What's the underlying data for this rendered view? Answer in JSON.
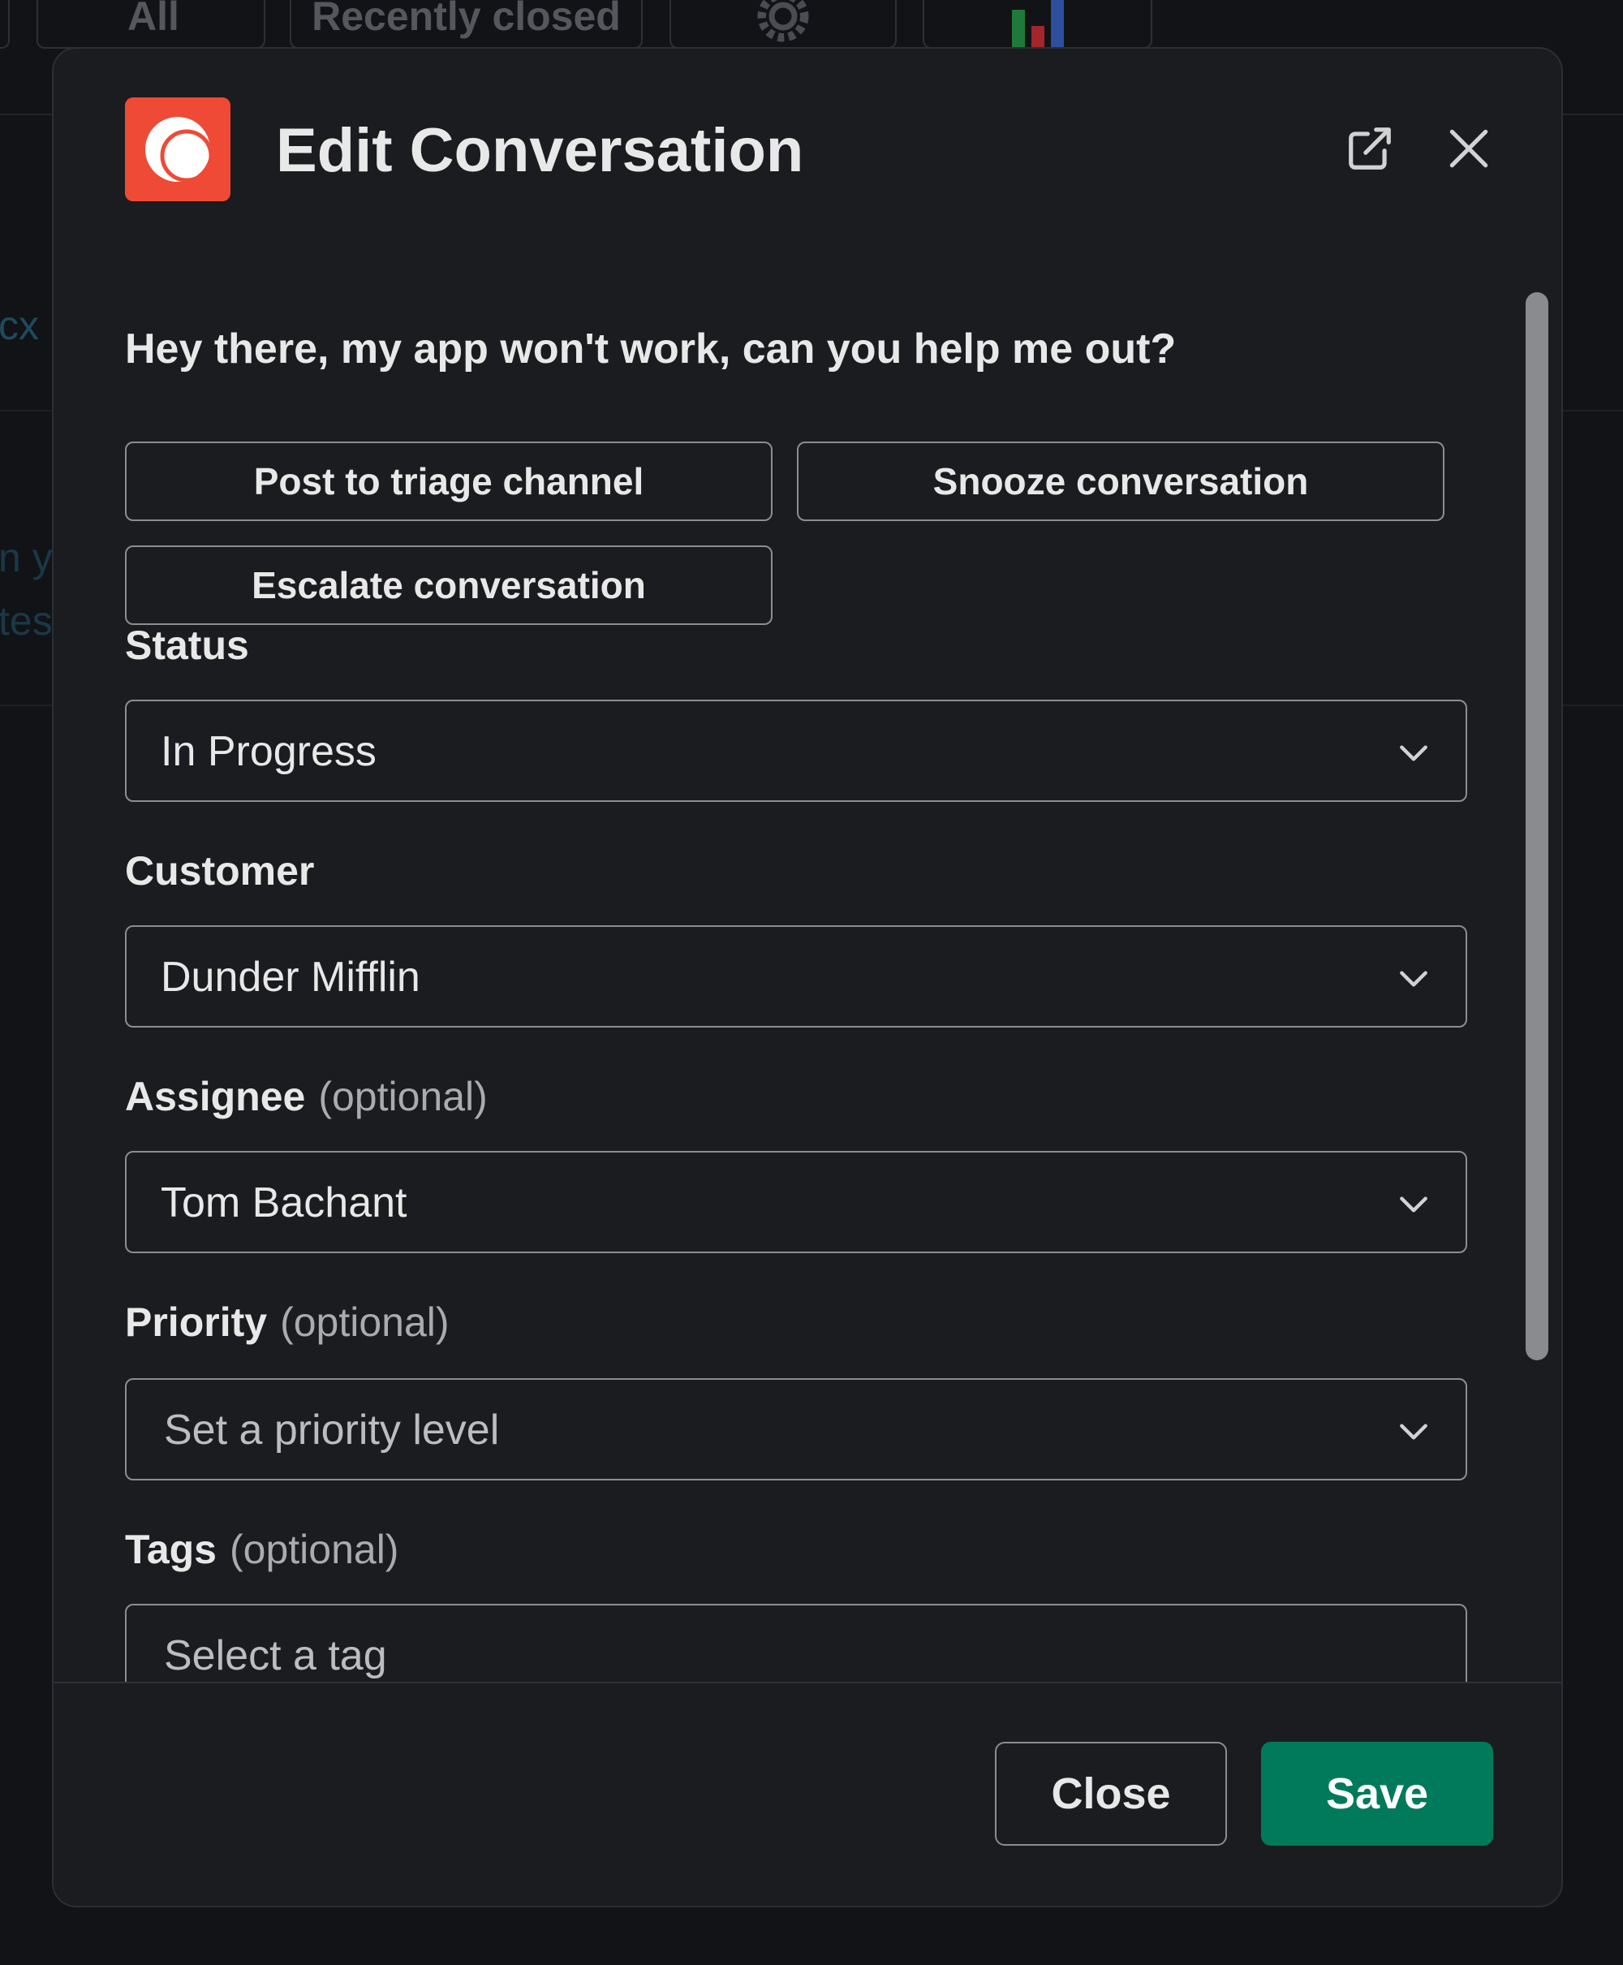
{
  "background": {
    "tabs": [
      "All",
      "Recently closed"
    ],
    "fragments": [
      "cx",
      "n y",
      "tes"
    ]
  },
  "modal": {
    "title": "Edit Conversation",
    "message": "Hey there, my app won't work, can you help me out?",
    "actions": {
      "post_triage": "Post to triage channel",
      "snooze": "Snooze conversation",
      "escalate": "Escalate conversation"
    },
    "fields": {
      "status": {
        "label": "Status",
        "value": "In Progress"
      },
      "customer": {
        "label": "Customer",
        "value": "Dunder Mifflin"
      },
      "assignee": {
        "label": "Assignee",
        "optional": "(optional)",
        "value": "Tom Bachant"
      },
      "priority": {
        "label": "Priority",
        "optional": "(optional)",
        "placeholder": "Set a priority level"
      },
      "tags": {
        "label": "Tags",
        "optional": "(optional)",
        "placeholder": "Select a tag"
      }
    },
    "footer": {
      "close_label": "Close",
      "save_label": "Save"
    }
  },
  "colors": {
    "background": "#121316",
    "modal": "#1b1c1f",
    "logo": "#ee4a35",
    "save_button": "#007a5a",
    "border": "#8c8d90"
  },
  "icons": {
    "logo": "app-logo-icon",
    "popout": "external-link-icon",
    "close": "close-icon",
    "dropdown": "chevron-down-icon"
  }
}
